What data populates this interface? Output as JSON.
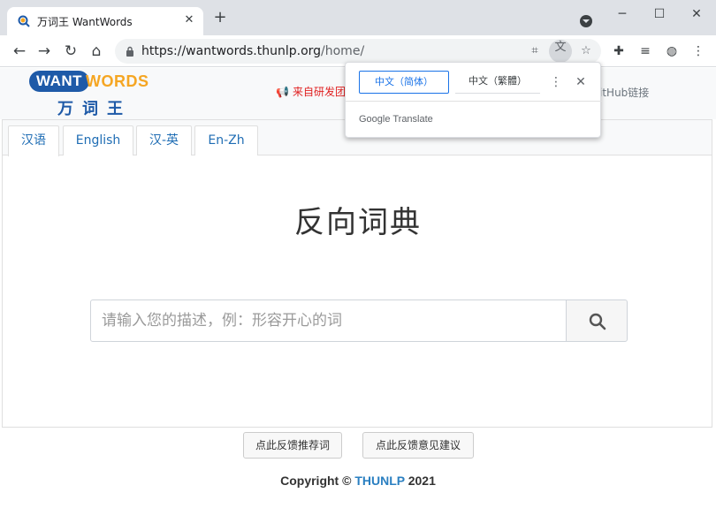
{
  "browser": {
    "tab_title": "万词王 WantWords",
    "tab_close": "✕",
    "new_tab": "+",
    "url_domain": "https://wantwords.thunlp.org",
    "url_path": "/home/",
    "window_min": "─",
    "window_max": "☐",
    "window_close": "✕"
  },
  "header": {
    "logo_want": "WANT",
    "logo_words": "WORDS",
    "logo_cn": "万词王",
    "announcement": "来自研发团",
    "github_text": "itHub链接"
  },
  "tabs": [
    {
      "label": "汉语",
      "active": true
    },
    {
      "label": "English",
      "active": false
    },
    {
      "label": "汉-英",
      "active": false
    },
    {
      "label": "En-Zh",
      "active": false
    }
  ],
  "main": {
    "heading": "反向词典",
    "search_placeholder": "请输入您的描述，例：形容开心的词"
  },
  "footer": {
    "feedback_recommend": "点此反馈推荐词",
    "feedback_suggest": "点此反馈意见建议",
    "copyright_prefix": "Copyright ©",
    "copyright_brand": "THUNLP",
    "copyright_year": "2021"
  },
  "translate_popup": {
    "lang_simplified": "中文（简体）",
    "lang_traditional": "中文（繁體）",
    "brand_google": "Google",
    "brand_translate": "Translate"
  },
  "colors": {
    "accent_blue": "#1f6db4",
    "logo_orange": "#f5a623",
    "announcement_red": "#e02020"
  }
}
